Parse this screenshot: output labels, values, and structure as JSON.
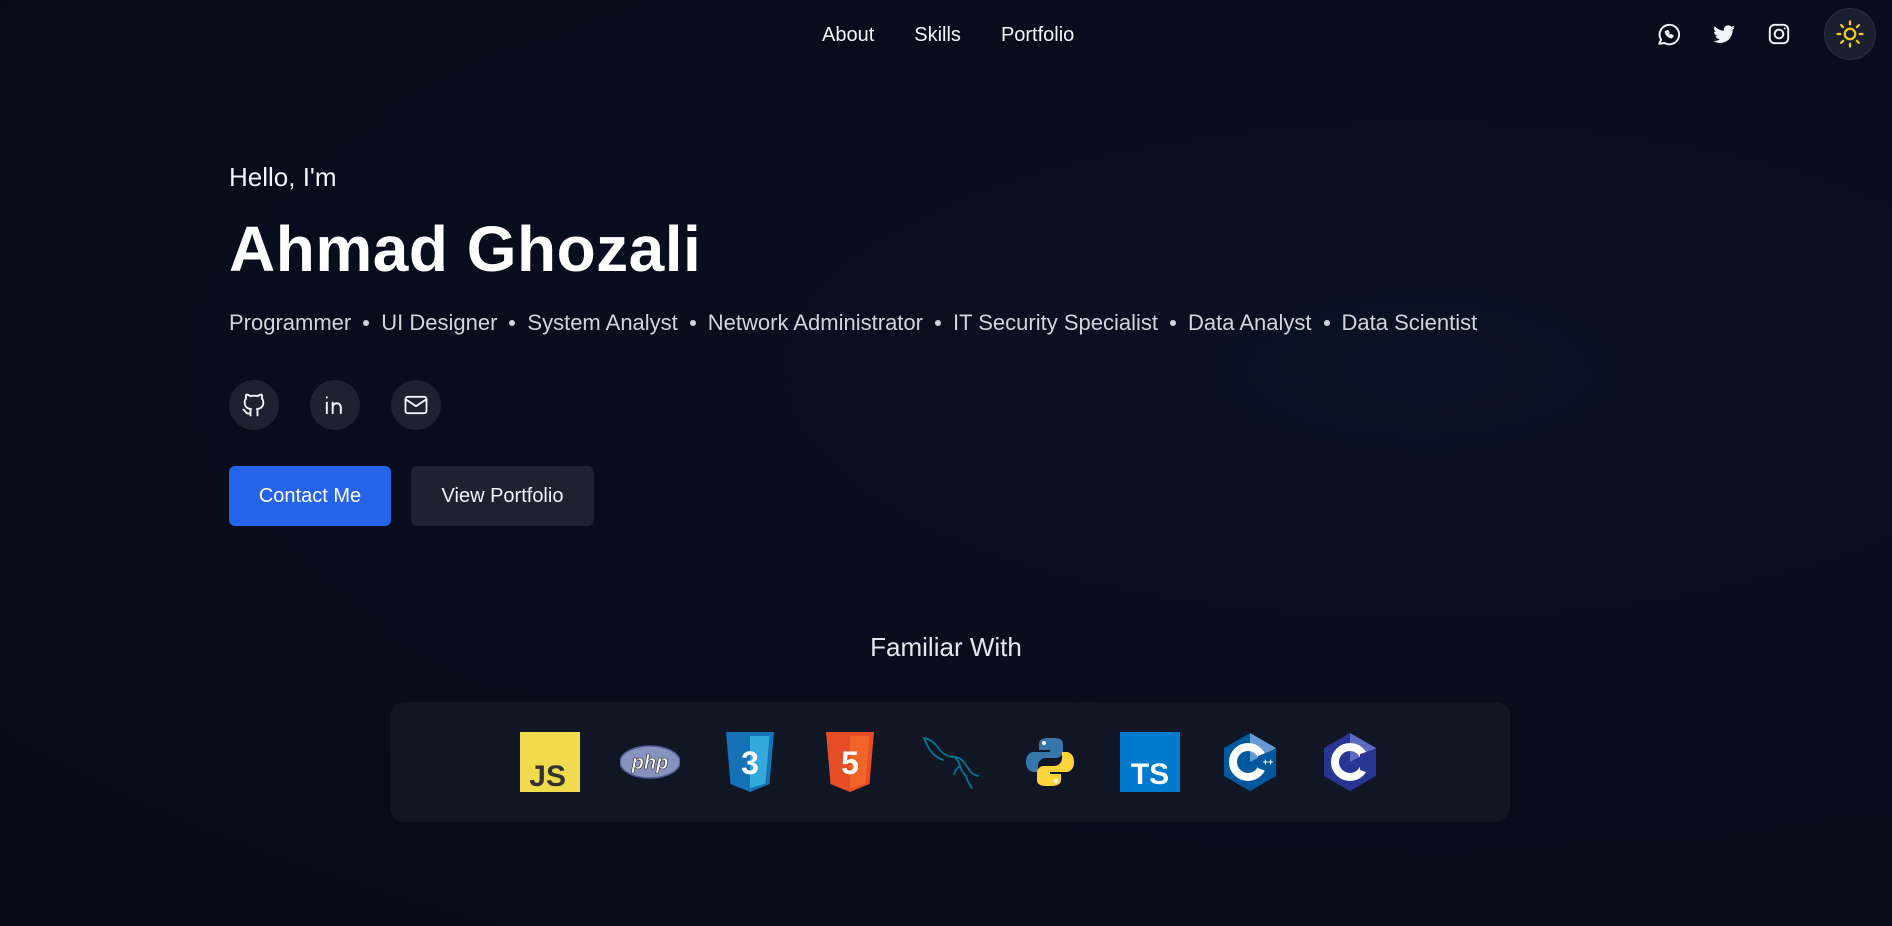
{
  "nav": {
    "links": [
      "About",
      "Skills",
      "Portfolio"
    ],
    "socials": [
      "whatsapp-icon",
      "twitter-icon",
      "instagram-icon"
    ],
    "theme_toggle": "sun-icon"
  },
  "hero": {
    "greeting": "Hello, I'm",
    "name": "Ahmad Ghozali",
    "roles": [
      "Programmer",
      "UI Designer",
      "System Analyst",
      "Network Administrator",
      "IT Security Specialist",
      "Data Analyst",
      "Data Scientist"
    ],
    "socials": [
      "github-icon",
      "linkedin-icon",
      "mail-icon"
    ],
    "contact_label": "Contact Me",
    "portfolio_label": "View Portfolio"
  },
  "familiar": {
    "title": "Familiar With",
    "technologies": [
      {
        "icon": "javascript-icon",
        "text": "JS",
        "color": "#f0db4f"
      },
      {
        "icon": "php-icon",
        "text": "php",
        "color": "#8892bf"
      },
      {
        "icon": "css3-icon",
        "text": "3",
        "color": "#2965f1"
      },
      {
        "icon": "html5-icon",
        "text": "5",
        "color": "#e44d26"
      },
      {
        "icon": "mysql-icon",
        "text": "",
        "color": "#00758f"
      },
      {
        "icon": "python-icon",
        "text": "",
        "color": "#3776ab"
      },
      {
        "icon": "typescript-icon",
        "text": "TS",
        "color": "#007acc"
      },
      {
        "icon": "cplusplus-icon",
        "text": "C++",
        "color": "#004482"
      },
      {
        "icon": "c-icon",
        "text": "C",
        "color": "#283593"
      }
    ]
  },
  "colors": {
    "background": "#080c1c",
    "primary": "#2563eb",
    "panel": "#111625",
    "sun": "#facc15"
  }
}
